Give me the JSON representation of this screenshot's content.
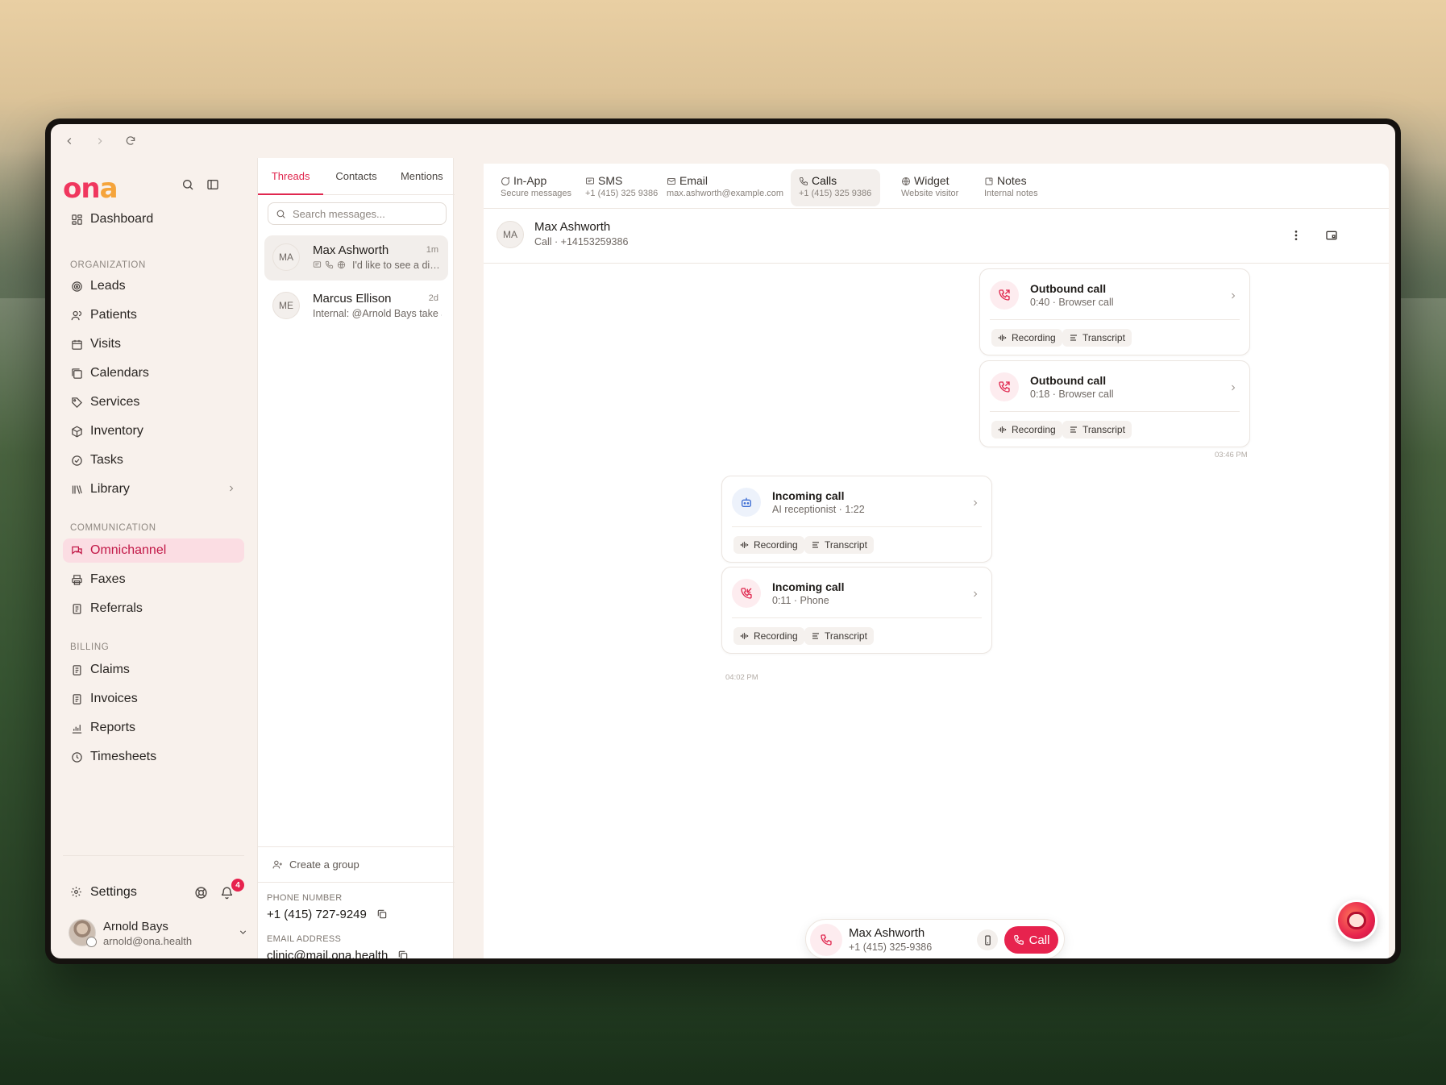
{
  "sidebar": {
    "logo": "ona",
    "nav_top": [
      {
        "label": "Dashboard",
        "icon": "dashboard-icon"
      }
    ],
    "sections": [
      {
        "title": "ORGANIZATION",
        "items": [
          {
            "label": "Leads",
            "icon": "target-icon"
          },
          {
            "label": "Patients",
            "icon": "users-icon"
          },
          {
            "label": "Visits",
            "icon": "calendar-icon"
          },
          {
            "label": "Calendars",
            "icon": "calendars-icon"
          },
          {
            "label": "Services",
            "icon": "tag-icon"
          },
          {
            "label": "Inventory",
            "icon": "box-icon"
          },
          {
            "label": "Tasks",
            "icon": "check-circle-icon"
          },
          {
            "label": "Library",
            "icon": "library-icon"
          }
        ]
      },
      {
        "title": "COMMUNICATION",
        "items": [
          {
            "label": "Omnichannel",
            "icon": "chat-icon",
            "active": true
          },
          {
            "label": "Faxes",
            "icon": "printer-icon"
          },
          {
            "label": "Referrals",
            "icon": "document-icon"
          }
        ]
      },
      {
        "title": "BILLING",
        "items": [
          {
            "label": "Claims",
            "icon": "document-icon"
          },
          {
            "label": "Invoices",
            "icon": "document-icon"
          },
          {
            "label": "Reports",
            "icon": "chart-icon"
          },
          {
            "label": "Timesheets",
            "icon": "clock-icon"
          }
        ]
      }
    ],
    "settings_label": "Settings",
    "notification_count": "4",
    "user": {
      "name": "Arnold Bays",
      "email": "arnold@ona.health"
    }
  },
  "threads": {
    "tabs": [
      "Threads",
      "Contacts",
      "Mentions"
    ],
    "active_tab": "Threads",
    "search_placeholder": "Search messages...",
    "items": [
      {
        "initials": "MA",
        "name": "Max Ashworth",
        "time": "1m",
        "preview": "I'd like to see a diatician"
      },
      {
        "initials": "ME",
        "name": "Marcus Ellison",
        "time": "2d",
        "preview": "Internal: @Arnold Bays take a loo..."
      }
    ],
    "create_group": "Create a group",
    "phone_label": "PHONE NUMBER",
    "phone_value": "+1 (415) 727-9249",
    "email_label": "EMAIL ADDRESS",
    "email_value": "clinic@mail.ona.health"
  },
  "channels": [
    {
      "label": "In-App",
      "sub": "Secure messages",
      "icon": "chat-bubble-icon"
    },
    {
      "label": "SMS",
      "sub": "+1 (415) 325 9386",
      "icon": "sms-icon"
    },
    {
      "label": "Email",
      "sub": "max.ashworth@example.com",
      "icon": "mail-icon"
    },
    {
      "label": "Calls",
      "sub": "+1 (415) 325 9386",
      "icon": "phone-icon",
      "active": true
    },
    {
      "label": "Widget",
      "sub": "Website visitor",
      "icon": "globe-icon"
    },
    {
      "label": "Notes",
      "sub": "Internal notes",
      "icon": "note-icon"
    }
  ],
  "conversation": {
    "initials": "MA",
    "name": "Max Ashworth",
    "subtitle": "Call · +14153259386",
    "calls": [
      {
        "title": "Outbound call",
        "sub": "0:40 · Browser call",
        "kind": "outbound"
      },
      {
        "title": "Outbound call",
        "sub": "0:18 · Browser call",
        "kind": "outbound"
      },
      {
        "title": "Incoming call",
        "sub": "AI receptionist · 1:22",
        "kind": "ai"
      },
      {
        "title": "Incoming call",
        "sub": "0:11 · Phone",
        "kind": "incoming"
      }
    ],
    "recording_label": "Recording",
    "transcript_label": "Transcript",
    "time_stamp_1": "03:46 PM",
    "time_stamp_2": "04:02 PM"
  },
  "callbar": {
    "name": "Max Ashworth",
    "number": "+1 (415) 325-9386",
    "call_label": "Call"
  },
  "colors": {
    "accent": "#e7234e",
    "accent_soft": "#fbdde3",
    "logo_secondary": "#f5a43b"
  }
}
